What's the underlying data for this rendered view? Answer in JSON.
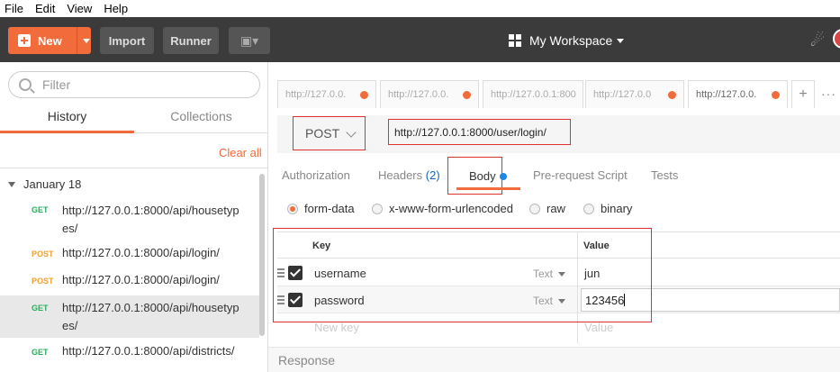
{
  "menu": [
    "File",
    "Edit",
    "View",
    "Help"
  ],
  "toolbar": {
    "new_label": "New",
    "import_label": "Import",
    "runner_label": "Runner",
    "workspace_label": "My Workspace"
  },
  "sidebar": {
    "filter_placeholder": "Filter",
    "tabs": [
      "History",
      "Collections"
    ],
    "clear_all": "Clear all",
    "group_label": "January 18",
    "history": [
      {
        "method": "GET",
        "url": "http://127.0.0.1:8000/api/housetypes/"
      },
      {
        "method": "POST",
        "url": "http://127.0.0.1:8000/api/login/"
      },
      {
        "method": "POST",
        "url": "http://127.0.0.1:8000/api/login/"
      },
      {
        "method": "GET",
        "url": "http://127.0.0.1:8000/api/housetypes/"
      },
      {
        "method": "GET",
        "url": "http://127.0.0.1:8000/api/districts/"
      }
    ]
  },
  "request_tabs": [
    "http://127.0.0.",
    "http://127.0.0.",
    "http://127.0.0.1:800",
    "http://127.0.0",
    "http://127.0.0."
  ],
  "request": {
    "method": "POST",
    "url": "http://127.0.0.1:8000/user/login/"
  },
  "subtabs": {
    "authorization": "Authorization",
    "headers": "Headers",
    "headers_count": "(2)",
    "body": "Body",
    "prerequest": "Pre-request Script",
    "tests": "Tests"
  },
  "body_modes": [
    "form-data",
    "x-www-form-urlencoded",
    "raw",
    "binary"
  ],
  "table": {
    "key_header": "Key",
    "value_header": "Value",
    "rows": [
      {
        "key": "username",
        "type": "Text",
        "value": "jun"
      },
      {
        "key": "password",
        "type": "Text",
        "value": "123456"
      }
    ],
    "new_key_placeholder": "New key",
    "new_value_placeholder": "Value"
  },
  "response_label": "Response",
  "colors": {
    "accent": "#f26b3a",
    "topbar": "#3b3b3b",
    "highlight_box": "#e03030"
  }
}
